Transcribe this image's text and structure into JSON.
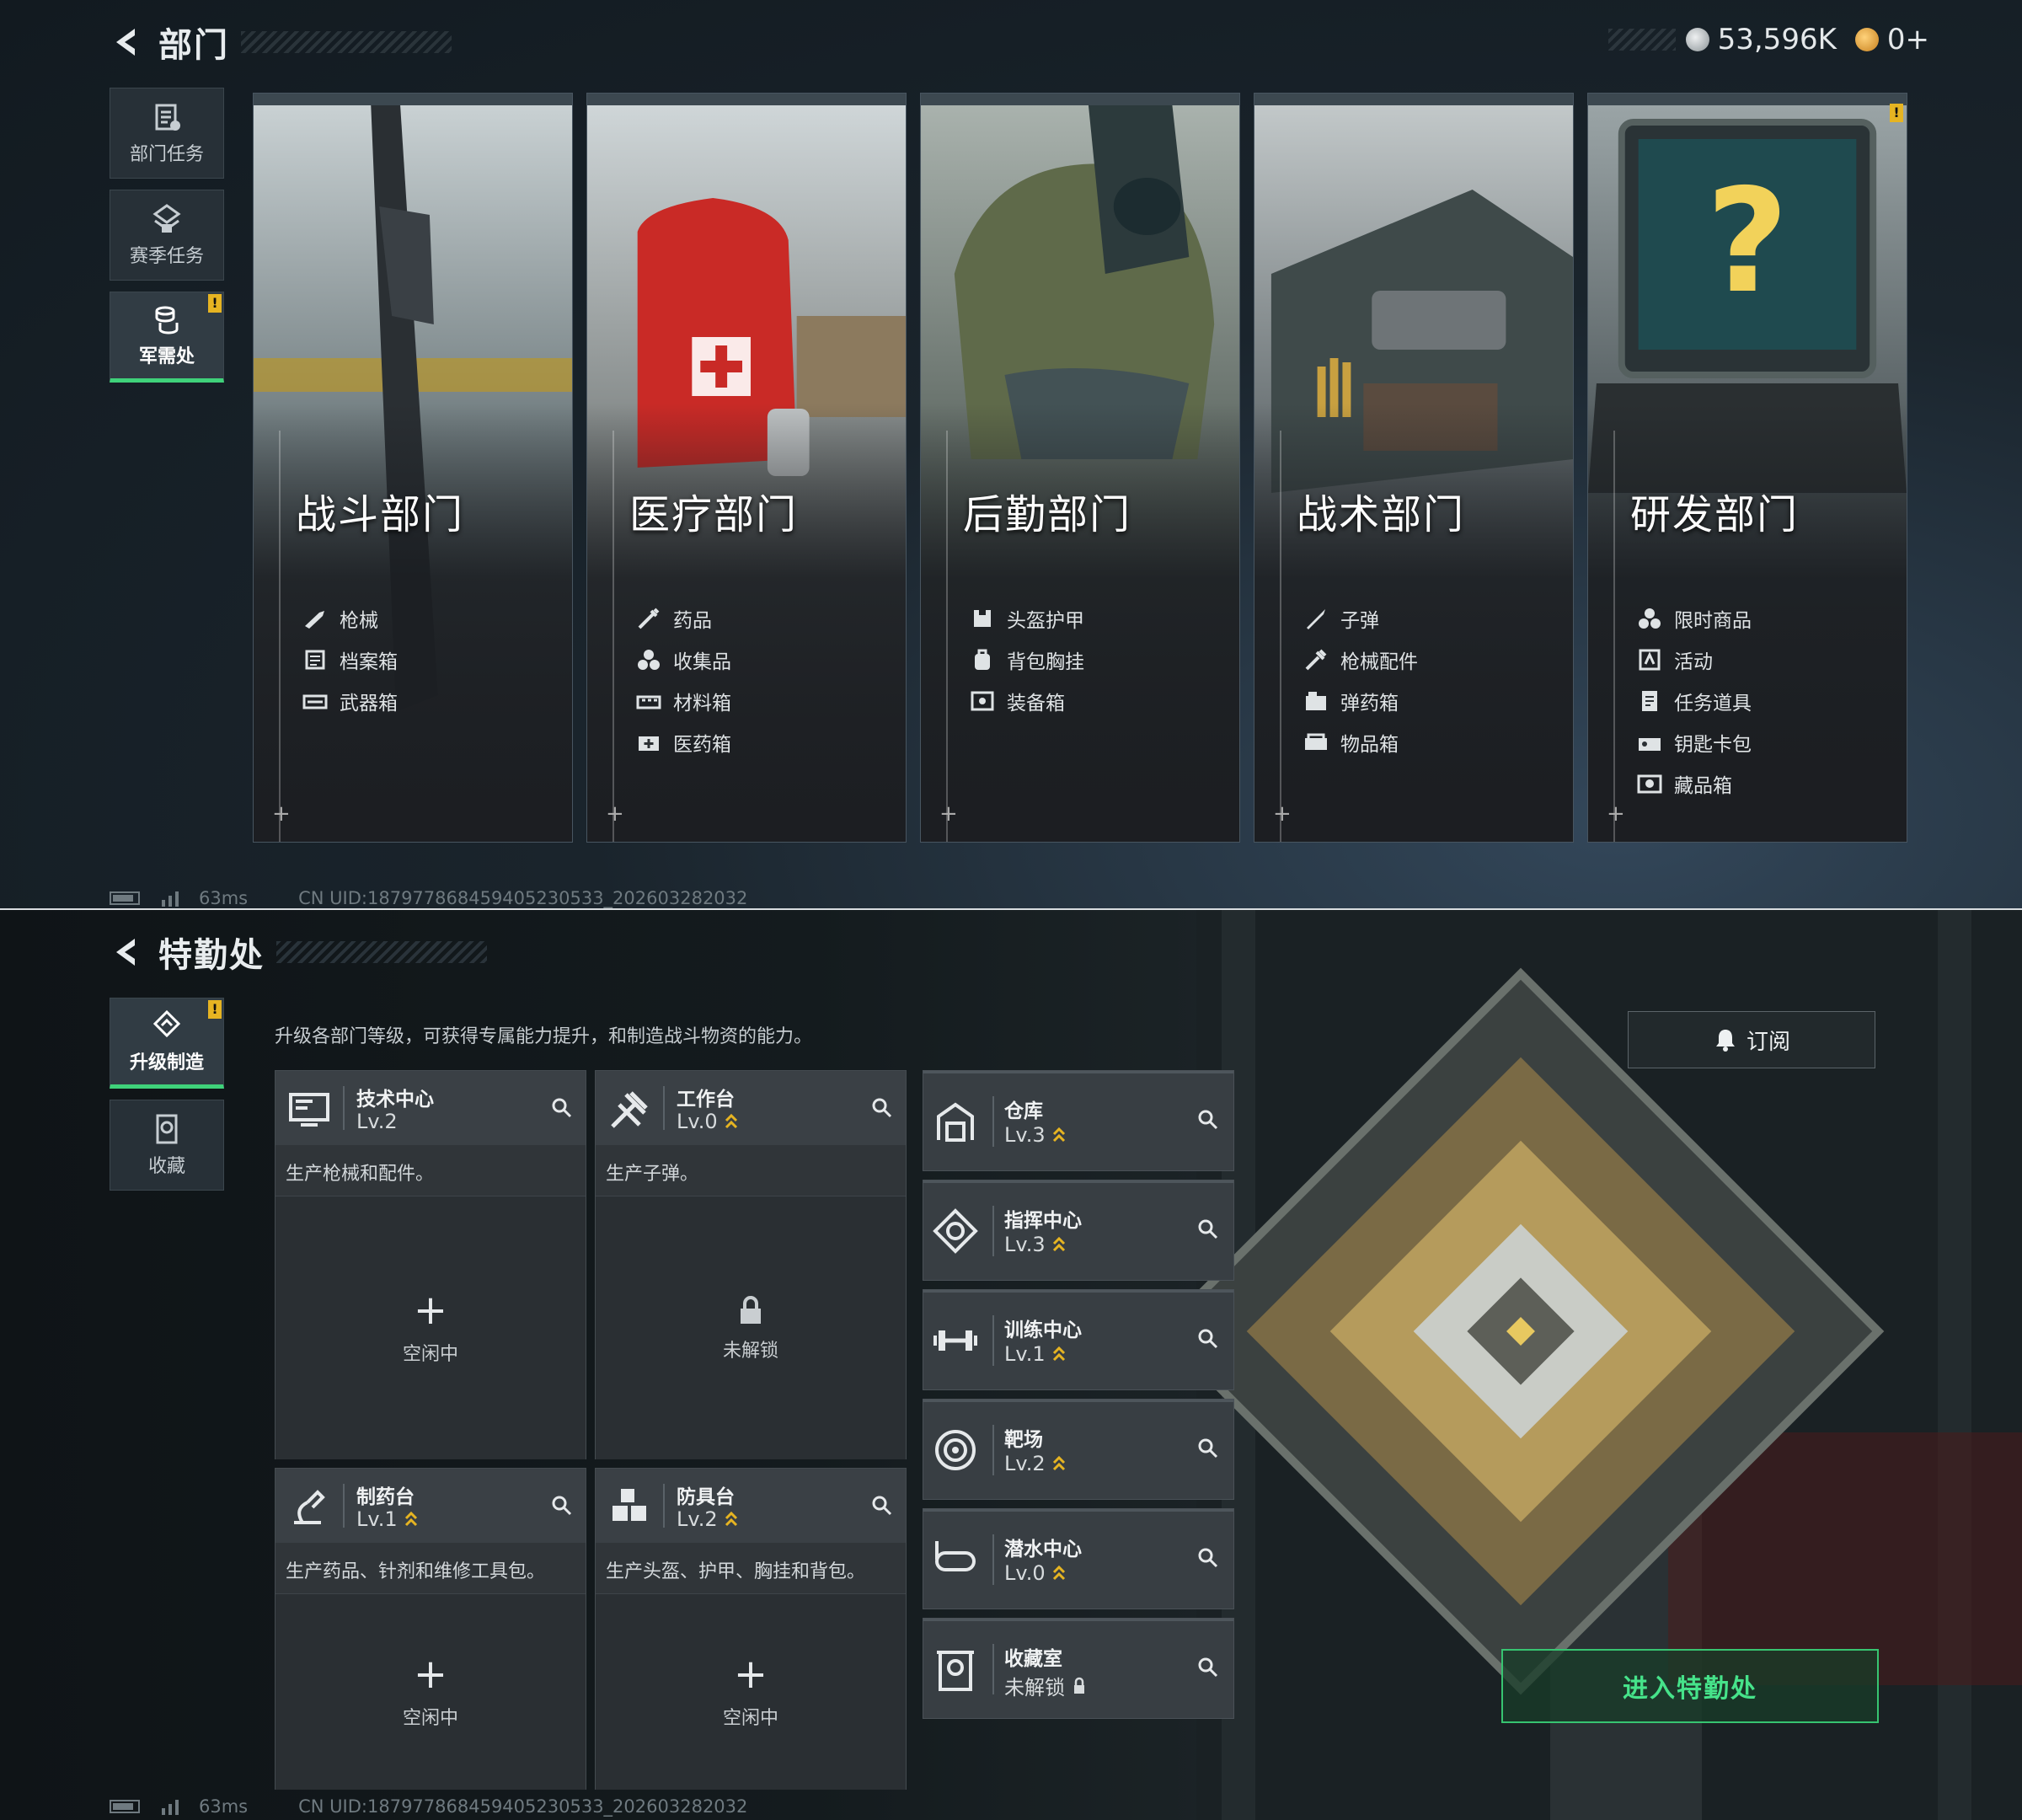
{
  "panel1": {
    "title": "部门",
    "currency": {
      "coin_value": "53,596K",
      "token_value": "0+",
      "colors": {
        "coin": "#c9ced1",
        "token": "#e0a53a"
      }
    },
    "nav": [
      {
        "label": "部门任务",
        "icon": "department-task-icon"
      },
      {
        "label": "赛季任务",
        "icon": "season-task-icon"
      },
      {
        "label": "军需处",
        "icon": "quartermaster-icon",
        "active": true,
        "badge": "!"
      }
    ],
    "cards": [
      {
        "name": "战斗部门",
        "items": [
          "枪械",
          "档案箱",
          "武器箱"
        ]
      },
      {
        "name": "医疗部门",
        "items": [
          "药品",
          "收集品",
          "材料箱",
          "医药箱"
        ]
      },
      {
        "name": "后勤部门",
        "items": [
          "头盔护甲",
          "背包胸挂",
          "装备箱"
        ]
      },
      {
        "name": "战术部门",
        "items": [
          "子弹",
          "枪械配件",
          "弹药箱",
          "物品箱"
        ]
      },
      {
        "name": "研发部门",
        "items": [
          "限时商品",
          "活动",
          "任务道具",
          "钥匙卡包",
          "藏品箱"
        ],
        "badge": "!"
      }
    ],
    "status": {
      "ping": "63ms",
      "uid": "CN UID:187977868459405230533_202603282032"
    }
  },
  "panel2": {
    "title": "特勤处",
    "nav": [
      {
        "label": "升级制造",
        "icon": "upgrade-craft-icon",
        "active": true,
        "badge": "!"
      },
      {
        "label": "收藏",
        "icon": "collection-icon"
      }
    ],
    "intro": "升级各部门等级，可获得专属能力提升，和制造战斗物资的能力。",
    "subscribe_label": "订阅",
    "enter_label": "进入特勤处",
    "accent": "#3fd27a",
    "production": [
      {
        "name": "技术中心",
        "level": "Lv.2",
        "upgradable": false,
        "desc": "生产枪械和配件。",
        "state_symbol": "+",
        "state": "空闲中",
        "icon": "tech-center-icon"
      },
      {
        "name": "工作台",
        "level": "Lv.0",
        "upgradable": true,
        "desc": "生产子弹。",
        "state_symbol": "lock",
        "state": "未解锁",
        "icon": "workbench-icon"
      },
      {
        "name": "制药台",
        "level": "Lv.1",
        "upgradable": true,
        "desc": "生产药品、针剂和维修工具包。",
        "state_symbol": "+",
        "state": "空闲中",
        "icon": "pharmacy-icon"
      },
      {
        "name": "防具台",
        "level": "Lv.2",
        "upgradable": true,
        "desc": "生产头盔、护甲、胸挂和背包。",
        "state_symbol": "+",
        "state": "空闲中",
        "icon": "armor-bench-icon"
      }
    ],
    "facilities": [
      {
        "name": "仓库",
        "level": "Lv.3",
        "upgradable": true,
        "icon": "warehouse-icon"
      },
      {
        "name": "指挥中心",
        "level": "Lv.3",
        "upgradable": true,
        "icon": "command-center-icon"
      },
      {
        "name": "训练中心",
        "level": "Lv.1",
        "upgradable": true,
        "icon": "training-center-icon"
      },
      {
        "name": "靶场",
        "level": "Lv.2",
        "upgradable": true,
        "icon": "shooting-range-icon"
      },
      {
        "name": "潜水中心",
        "level": "Lv.0",
        "upgradable": true,
        "icon": "diving-center-icon"
      },
      {
        "name": "收藏室",
        "level": "未解锁",
        "locked": true,
        "icon": "collection-room-icon"
      }
    ],
    "status": {
      "ping": "63ms",
      "uid": "CN UID:187977868459405230533_202603282032"
    }
  }
}
